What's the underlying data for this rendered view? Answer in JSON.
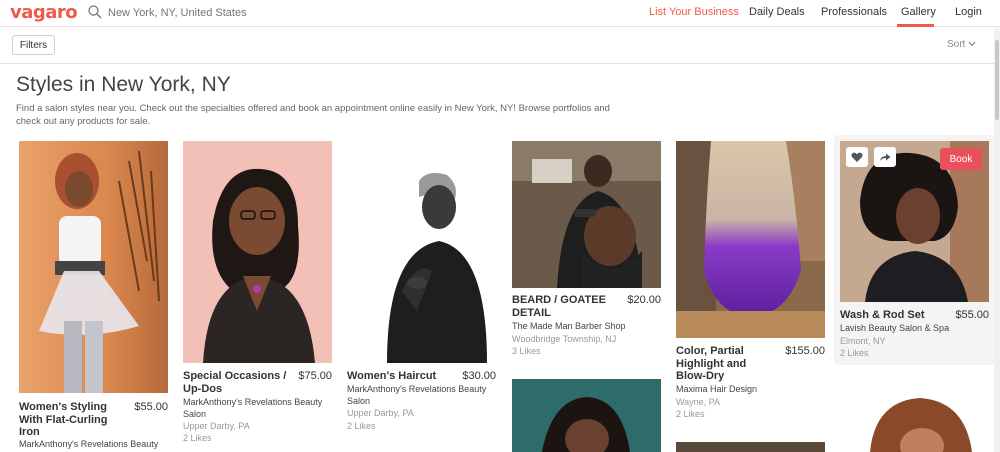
{
  "header": {
    "logo": "vagaro",
    "search_placeholder": "New York, NY, United States",
    "nav": {
      "list_business": "List Your Business",
      "daily_deals": "Daily Deals",
      "professionals": "Professionals",
      "gallery": "Gallery",
      "login": "Login"
    }
  },
  "toolbar": {
    "filters_label": "Filters",
    "sort_label": "Sort"
  },
  "page": {
    "title": "Styles in New York, NY",
    "description": "Find a salon styles near you. Check out the specialties offered and book an appointment online easily in New York, NY! Browse portfolios and check out any products for sale."
  },
  "cards": [
    {
      "name": "Women's Styling With Flat-Curling Iron",
      "price": "$55.00",
      "salon": "MarkAnthony's Revelations Beauty",
      "location": "",
      "likes": ""
    },
    {
      "name": "Special Occasions / Up-Dos",
      "price": "$75.00",
      "salon": "MarkAnthony's Revelations Beauty Salon",
      "location": "Upper Darby, PA",
      "likes": "2 Likes"
    },
    {
      "name": "Women's Haircut",
      "price": "$30.00",
      "salon": "MarkAnthony's Revelations Beauty Salon",
      "location": "Upper Darby, PA",
      "likes": "2 Likes"
    },
    {
      "name": "BEARD / GOATEE DETAIL",
      "price": "$20.00",
      "salon": "The Made Man Barber Shop",
      "location": "Woodbridge Township, NJ",
      "likes": "3 Likes"
    },
    {
      "name": "Color, Partial Highlight and Blow-Dry",
      "price": "$155.00",
      "salon": "Maxima Hair Design",
      "location": "Wayne, PA",
      "likes": "2 Likes"
    },
    {
      "name": "Wash & Rod Set",
      "price": "$55.00",
      "salon": "Lavish Beauty Salon & Spa",
      "location": "Elmont, NY",
      "likes": "2 Likes",
      "book_label": "Book"
    }
  ],
  "colors": {
    "accent": "#f05a4a",
    "book": "#e8505b"
  }
}
